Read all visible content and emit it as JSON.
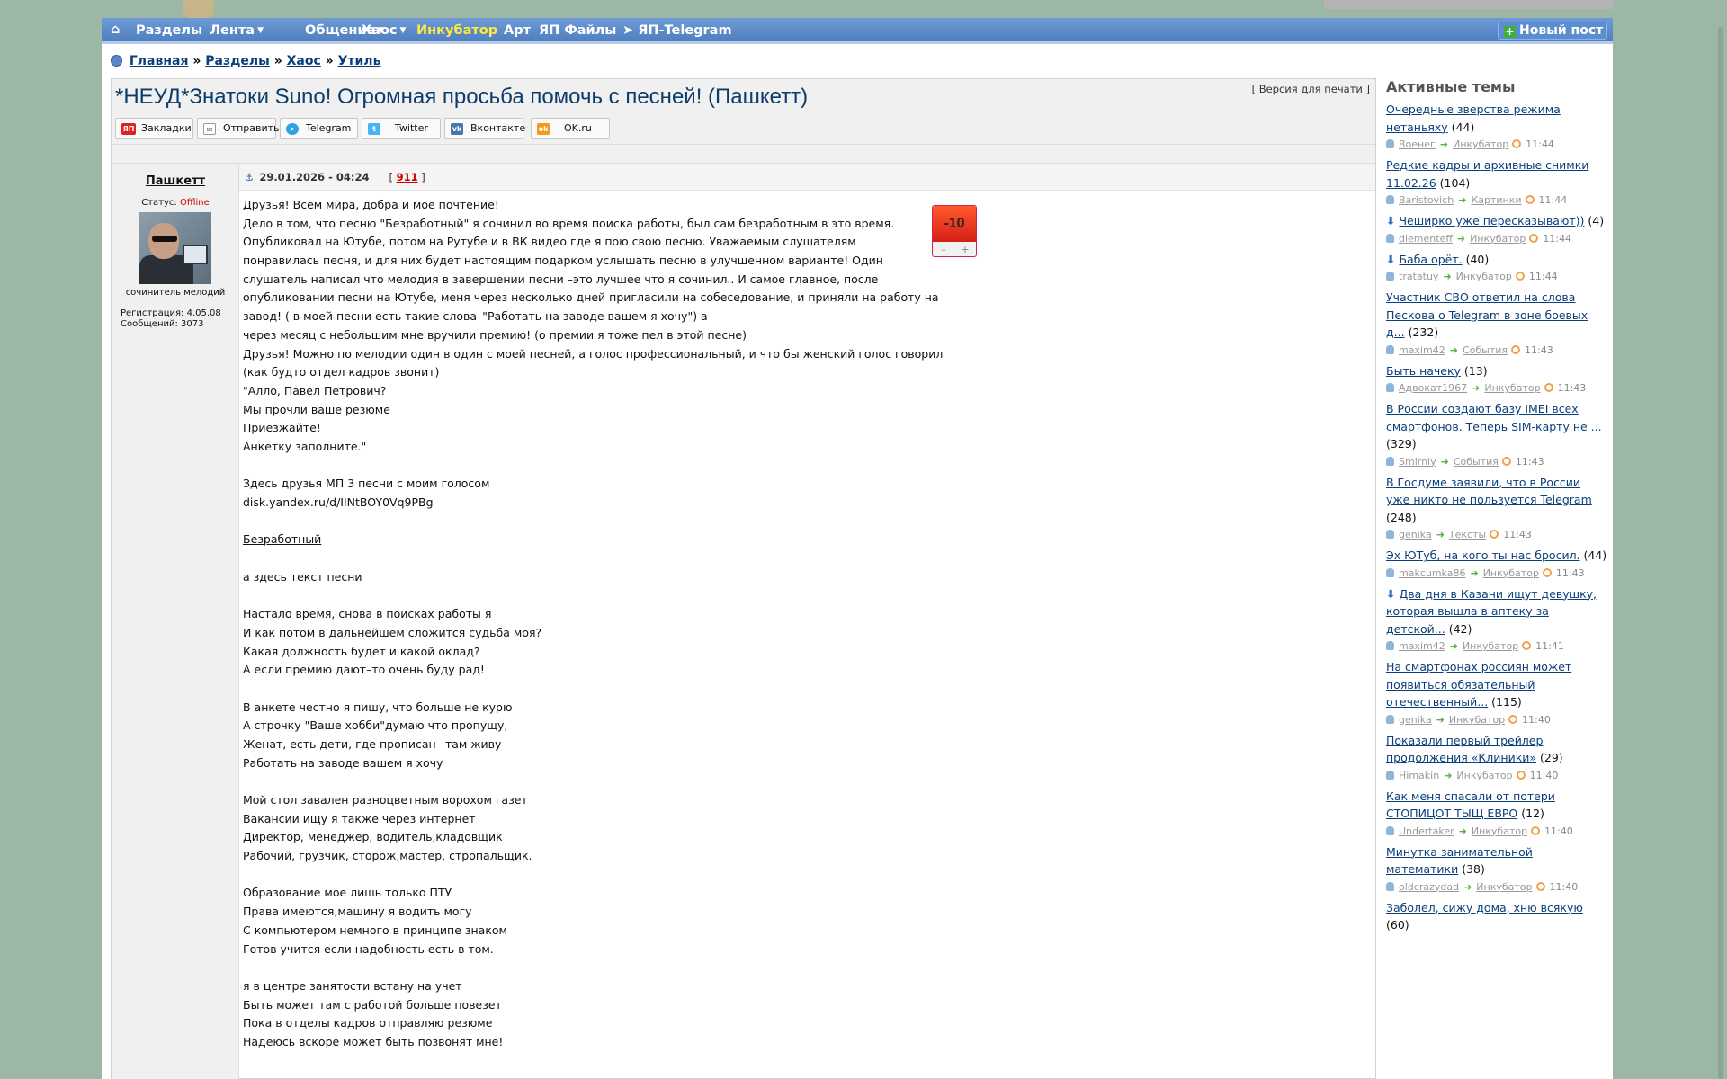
{
  "nav": {
    "home_icon": "home-icon",
    "items": [
      {
        "label": "Разделы",
        "caret": false
      },
      {
        "label": "Лента",
        "caret": true
      },
      {
        "label": "Общение",
        "caret": true
      },
      {
        "label": "Хаос",
        "caret": true
      },
      {
        "label": "Инкубатор",
        "caret": false,
        "highlight": true
      },
      {
        "label": "Арт",
        "caret": false
      },
      {
        "label": "ЯП Файлы",
        "caret": false
      },
      {
        "label": "ЯП-Telegram",
        "caret": false
      }
    ],
    "new_post": "Новый пост"
  },
  "breadcrumbs": [
    "Главная",
    "Разделы",
    "Хаос",
    "Утиль"
  ],
  "topic": {
    "title": "*НЕУД*Знатоки Suno! Огромная просьба помочь с песней! (Пашкетт)",
    "print_version": "Версия для печати"
  },
  "share": [
    "Закладки",
    "Отправить",
    "Telegram",
    "Twitter",
    "Вконтакте",
    "OK.ru"
  ],
  "post": {
    "author": "Пашкетт",
    "status_label": "Статус:",
    "status": "Offline",
    "avatar_caption": "сочинитель мелодий",
    "registration": "Регистрация: 4.05.08",
    "messages": "Сообщений: 3073",
    "date": "29.01.2026 - 04:24",
    "number": "911",
    "rating": "-10",
    "lines": [
      "Друзья! Всем мира, добра и мое почтение!",
      "Дело в том, что песню \"Безработный\" я сочинил во время поиска работы, был сам безработным в это время.",
      "Опубликовал на Ютубе, потом на Рутубе и в ВК видео где я пою свою песню. Уважаемым слушателям",
      "понравилась песня, и для них будет настоящим подарком услышать песню в улучшенном варианте! Один",
      "слушатель написал что мелодия в завершении песни –это лучшее что я сочинил.. И самое главное, после",
      "опубликовании песни на Ютубе, меня через несколько дней пригласили на собеседование, и приняли на работу на",
      "завод! ( в моей песни есть такие слова–\"Работать на заводе вашем я хочу\") а",
      "через месяц с небольшим мне вручили премию! (о премии я тоже пел в этой песне)",
      "Друзья! Можно по мелодии один в один с моей песней, а голос профессиональный, и что бы женский голос говорил",
      "(как будто отдел кадров звонит)",
      "\"Алло, Павел Петрович?",
      "Мы прочли ваше резюме",
      "Приезжайте!",
      "Анкетку заполните.\"",
      "",
      "Здесь друзья МП 3 песни с моим голосом",
      "disk.yandex.ru/d/IINtBOY0Vq9PBg",
      "",
      "Безработный",
      "",
      "а здесь текст песни",
      "",
      "Настало время, снова в поисках работы я",
      "И как потом в дальнейшем сложится судьба моя?",
      "Какая должность будет и какой оклад?",
      "А если премию дают–то очень буду рад!",
      "",
      "В анкете честно я пишу, что больше не курю",
      "А строчку \"Ваше хобби\"думаю что пропущу,",
      "Женат, есть дети, где прописан –там живу",
      "Работать на заводе вашем я хочу",
      "",
      "Мой стол завален разноцветным ворохом газет",
      "Вакансии ищу я также через интернет",
      "Директор, менеджер, водитель,кладовщик",
      "Рабочий, грузчик, сторож,мастер, стропальщик.",
      "",
      "Образование мое лишь только ПТУ",
      "Права имеются,машину я водить могу",
      "С компьютером немного в принципе знаком",
      "Готов учится если надобность есть в том.",
      "",
      "я в центре занятости встану на учет",
      "Быть может там с работой больше повезет",
      "Пока в отделы кадров отправляю резюме",
      "Надеюсь вскоре может быть позвонят мне!"
    ]
  },
  "sidebar": {
    "title": "Активные темы",
    "topics": [
      {
        "title": "Очередные зверства режима нетаньяху",
        "count": "(44)",
        "pinned": false,
        "user": "Военег",
        "section": "Инкубатор",
        "time": "11:44"
      },
      {
        "title": "Редкие кадры и архивные снимки 11.02.26",
        "count": "(104)",
        "pinned": false,
        "user": "Baristovich",
        "section": "Картинки",
        "time": "11:44"
      },
      {
        "title": "Чеширко уже пересказывают))",
        "count": "(4)",
        "pinned": true,
        "user": "diementeff",
        "section": "Инкубатор",
        "time": "11:44"
      },
      {
        "title": "Баба орёт.",
        "count": "(40)",
        "pinned": true,
        "user": "tratatuy",
        "section": "Инкубатор",
        "time": "11:44"
      },
      {
        "title": "Участник СВО ответил на слова Пескова о Telegram в зоне боевых д...",
        "count": "(232)",
        "pinned": false,
        "user": "maxim42",
        "section": "События",
        "time": "11:43"
      },
      {
        "title": "Быть начеку",
        "count": "(13)",
        "pinned": false,
        "user": "Адвокат1967",
        "section": "Инкубатор",
        "time": "11:43"
      },
      {
        "title": "В России создают базу IMEI всех смартфонов. Теперь SIM-карту не ...",
        "count": "(329)",
        "pinned": false,
        "user": "Smirniy",
        "section": "События",
        "time": "11:43"
      },
      {
        "title": "В Госдуме заявили, что в России уже никто не пользуется Telegram",
        "count": "(248)",
        "pinned": false,
        "user": "genika",
        "section": "Тексты",
        "time": "11:43"
      },
      {
        "title": "Эх ЮТуб, на кого ты нас бросил.",
        "count": "(44)",
        "pinned": false,
        "user": "makcumka86",
        "section": "Инкубатор",
        "time": "11:43"
      },
      {
        "title": "Два дня в Казани ищут девушку, которая вышла в аптеку за детской...",
        "count": "(42)",
        "pinned": true,
        "user": "maxim42",
        "section": "Инкубатор",
        "time": "11:41"
      },
      {
        "title": "На смартфонах россиян может появиться обязательный отечественный...",
        "count": "(115)",
        "pinned": false,
        "user": "genika",
        "section": "Инкубатор",
        "time": "11:40"
      },
      {
        "title": "Показали первый трейлер продолжения «Клиники»",
        "count": "(29)",
        "pinned": false,
        "user": "Himakin",
        "section": "Инкубатор",
        "time": "11:40"
      },
      {
        "title": "Как меня спасали от потери СТОПИЦОТ ТЫЩ ЕВРО",
        "count": "(12)",
        "pinned": false,
        "user": "Undertaker",
        "section": "Инкубатор",
        "time": "11:40"
      },
      {
        "title": "Минутка занимательной математики",
        "count": "(38)",
        "pinned": false,
        "user": "oldcrazydad",
        "section": "Инкубатор",
        "time": "11:40"
      },
      {
        "title": "Заболел, сижу дома, хню всякую",
        "count": "(60)",
        "pinned": false,
        "user": "",
        "section": "",
        "time": ""
      }
    ]
  }
}
